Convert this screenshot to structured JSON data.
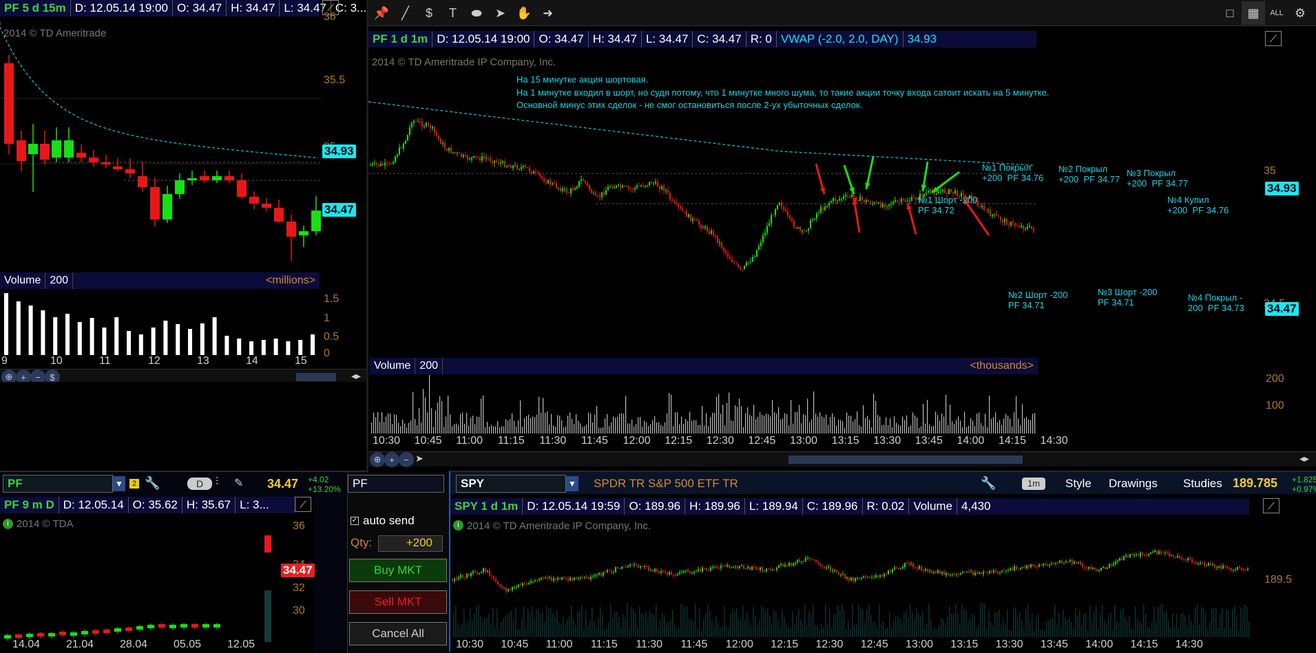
{
  "toolbar": {
    "tools": [
      "pin-icon",
      "line-icon",
      "dollar-icon",
      "text-icon",
      "ellipse-icon",
      "pointer-icon",
      "hand-icon",
      "arrow-right-icon"
    ],
    "tool_glyphs": [
      "📌",
      "╱",
      "$",
      "T",
      "⬬",
      "➤",
      "✋",
      "➜"
    ],
    "right_icons": [
      "single-layout-icon",
      "grid-layout-icon",
      "all-icon",
      "gear-icon"
    ],
    "right_glyphs": [
      "□",
      "▦",
      "ALL",
      "⚙"
    ]
  },
  "chart_tl": {
    "symbol": "PF 5 d 15m",
    "date": "D: 12.05.14 19:00",
    "open": "O: 34.47",
    "high": "H: 34.47",
    "low": "L: 34.47",
    "close": "C: 3...",
    "copyright": "2014 © TD Ameritrade",
    "price_ticks": [
      "36",
      "35.5",
      "35"
    ],
    "vwap_tag": "34.93",
    "price_tag": "34.47",
    "volume_label": "Volume",
    "volume_period": "200",
    "volume_unit": "<millions>",
    "volume_ticks": [
      "1.5",
      "1",
      "0.5",
      "0"
    ],
    "x_ticks": [
      "9",
      "10",
      "11",
      "12",
      "13",
      "14",
      "15"
    ]
  },
  "chart_tr": {
    "symbol": "PF 1 d 1m",
    "date": "D: 12.05.14 19:00",
    "open": "O: 34.47",
    "high": "H: 34.47",
    "low": "L: 34.47",
    "close": "C: 34.47",
    "range": "R: 0",
    "vwap": "VWAP (-2.0, 2.0, DAY)",
    "vwap_value": "34.93",
    "copyright": "2014 © TD Ameritrade IP Company, Inc.",
    "note_lines": [
      "На 15 минутке акция шортовая.",
      "На 1 минутке входил в шорт, но судя потому, что 1 минутке много шума, то такие акции точку входа сатоит искать на 5 минутке.",
      "Основной минус этих сделок - не смог остановиться после 2-ух убыточных сделок."
    ],
    "annotations": [
      "№1 Шорт -200\nPF 34.72",
      "№1 Покрыл\n+200  PF 34.76",
      "№2 Покрыл\n+200  PF 34.77",
      "№3 Покрыл\n+200  PF 34.77",
      "№4 Купил\n+200  PF 34.76",
      "№2 Шорт -200\nPF 34.71",
      "№3 Шорт -200\nPF 34.71",
      "№4 Покрыл -\n200  PF 34.73"
    ],
    "price_ticks": [
      "35",
      "34.5"
    ],
    "vwap_tag": "34.93",
    "price_tag": "34.47",
    "volume_label": "Volume",
    "volume_period": "200",
    "volume_unit": "<thousands>",
    "volume_ticks": [
      "200",
      "100"
    ],
    "x_ticks": [
      "10:30",
      "10:45",
      "11:00",
      "11:15",
      "11:30",
      "11:45",
      "12:00",
      "12:15",
      "12:30",
      "12:45",
      "13:00",
      "13:15",
      "13:30",
      "13:45",
      "14:00",
      "14:15",
      "14:30"
    ]
  },
  "bottom_left": {
    "symbol_input": "PF",
    "link_badge": "2",
    "period_button": "D",
    "last_price": "34.47",
    "change": "+4.02",
    "change_pct": "+13.20%",
    "chart_symbol": "PF 9 m D",
    "date": "D: 12.05.14",
    "open": "O: 35.62",
    "high": "H: 35.67",
    "low": "L: 3...",
    "copyright": "2014 © TDA",
    "price_ticks": [
      "36",
      "34",
      "32",
      "30"
    ],
    "price_tag": "34.47",
    "x_ticks": [
      "14.04",
      "21.04",
      "28.04",
      "05.05",
      "12.05"
    ]
  },
  "order_panel": {
    "symbol": "PF",
    "auto_send_label": "auto send",
    "qty_label": "Qty:",
    "qty_value": "+200",
    "buy_label": "Buy MKT",
    "sell_label": "Sell MKT",
    "cancel_label": "Cancel All"
  },
  "bottom_right": {
    "symbol_input": "SPY",
    "description": "SPDR TR S&P 500 ETF TR",
    "period_button": "1m",
    "style_label": "Style",
    "drawings_label": "Drawings",
    "studies_label": "Studies",
    "last_price": "189.785",
    "change": "+1.825",
    "change_pct": "+0.97%",
    "chart_symbol": "SPY 1 d 1m",
    "date": "D: 12.05.14 19:59",
    "open": "O: 189.96",
    "high": "H: 189.96",
    "low": "L: 189.94",
    "close": "C: 189.96",
    "range": "R: 0.02",
    "volume": "Volume",
    "volume_value": "4,430",
    "copyright": "2014 © TD Ameritrade IP Company, Inc.",
    "price_ticks": [
      "189.5"
    ],
    "x_ticks": [
      "10:30",
      "10:45",
      "11:00",
      "11:15",
      "11:30",
      "11:45",
      "12:00",
      "12:15",
      "12:30",
      "12:45",
      "13:00",
      "13:15",
      "13:30",
      "13:45",
      "14:00",
      "14:15",
      "14:30"
    ]
  },
  "colors": {
    "up": "#16e016",
    "down": "#e81818",
    "vwap": "#1ec8d8",
    "accent": "#18e8f0"
  }
}
